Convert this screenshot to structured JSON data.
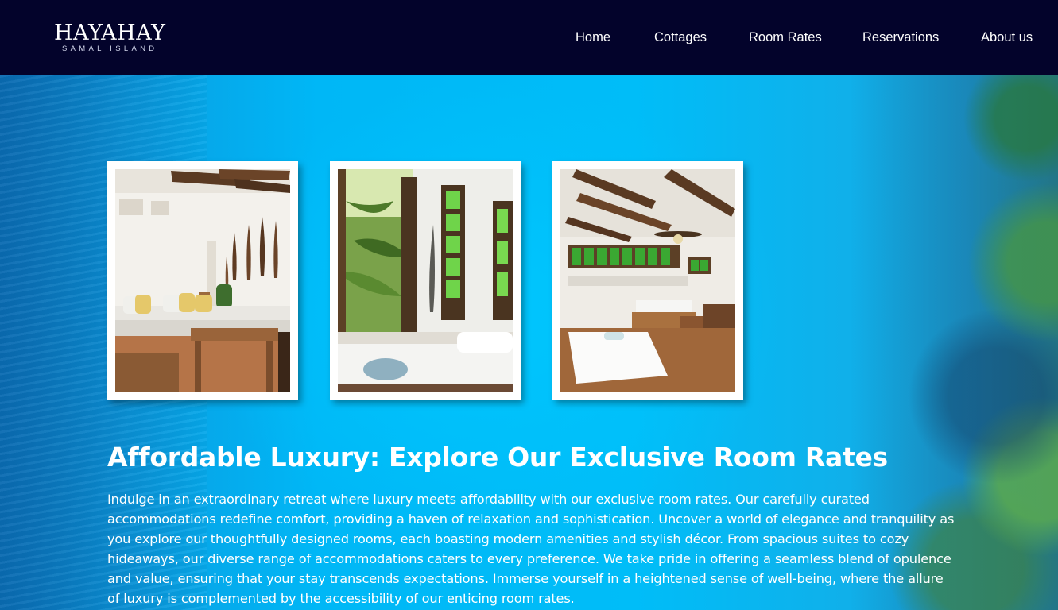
{
  "brand": {
    "name": "HAYAHAY",
    "tagline": "SAMAL ISLAND"
  },
  "nav": {
    "items": [
      {
        "label": "Home"
      },
      {
        "label": "Cottages"
      },
      {
        "label": "Room Rates"
      },
      {
        "label": "Reservations"
      },
      {
        "label": "About us"
      }
    ]
  },
  "gallery": {
    "photos": [
      {
        "subject": "bedroom-with-paddles-photo"
      },
      {
        "subject": "window-with-palm-view-photo"
      },
      {
        "subject": "room-with-ceiling-fan-photo"
      }
    ]
  },
  "hero": {
    "headline": "Affordable Luxury: Explore Our Exclusive Room Rates",
    "body": "Indulge in an extraordinary retreat where luxury meets affordability with our exclusive room rates. Our carefully curated accommodations redefine comfort, providing a haven of relaxation and sophistication. Uncover a world of elegance and tranquility as you explore our thoughtfully designed rooms, each boasting modern amenities and stylish décor. From spacious suites to cozy hideaways, our diverse range of accommodations caters to every preference. We take pride in offering a seamless blend of opulence and value, ensuring that your stay transcends expectations. Immerse yourself in a heightened sense of well-being, where the allure of luxury is complemented by the accessibility of our enticing room rates."
  },
  "colors": {
    "nav_background": "#03032b",
    "hero_accent": "#00bdf8",
    "text": "#ffffff"
  }
}
